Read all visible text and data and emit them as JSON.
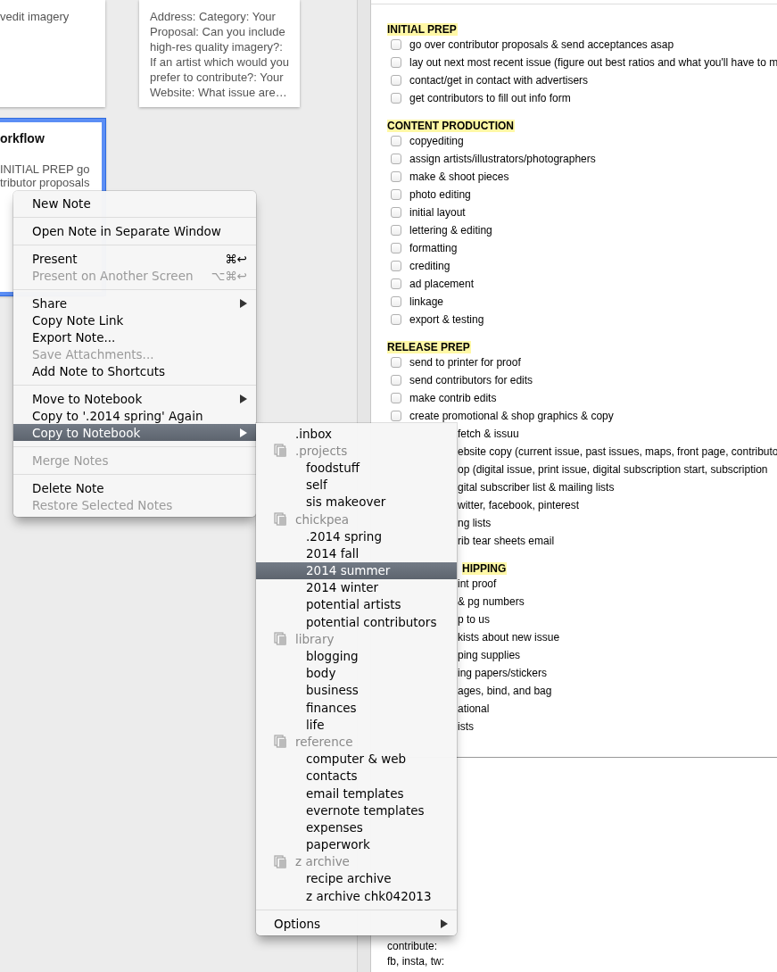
{
  "notes": [
    {
      "kind": "plain",
      "selected": false,
      "lines": [
        "vedit imagery"
      ]
    },
    {
      "kind": "plain",
      "selected": false,
      "lines": [
        "Address: Category: Your Proposal: Can you include high-res quality imagery?: If an artist which would you prefer to contribute?: Your Website: What issue are…"
      ]
    },
    {
      "kind": "titled",
      "selected": true,
      "title": "orkflow",
      "lines": [
        "INITIAL PREP go",
        "tributor proposals"
      ]
    }
  ],
  "context_menu": {
    "groups": [
      [
        {
          "label": "New Note",
          "disabled": false,
          "selected": false,
          "submenu": false
        }
      ],
      [
        {
          "label": "Open Note in Separate Window",
          "disabled": false,
          "selected": false,
          "submenu": false
        }
      ],
      [
        {
          "label": "Present",
          "disabled": false,
          "selected": false,
          "submenu": false,
          "shortcut": "⌘↩"
        },
        {
          "label": "Present on Another Screen",
          "disabled": true,
          "selected": false,
          "submenu": false,
          "shortcut": "⌥⌘↩"
        }
      ],
      [
        {
          "label": "Share",
          "disabled": false,
          "selected": false,
          "submenu": true
        },
        {
          "label": "Copy Note Link",
          "disabled": false,
          "selected": false,
          "submenu": false
        },
        {
          "label": "Export Note...",
          "disabled": false,
          "selected": false,
          "submenu": false
        },
        {
          "label": "Save Attachments...",
          "disabled": true,
          "selected": false,
          "submenu": false
        },
        {
          "label": "Add Note to Shortcuts",
          "disabled": false,
          "selected": false,
          "submenu": false
        }
      ],
      [
        {
          "label": "Move to Notebook",
          "disabled": false,
          "selected": false,
          "submenu": true
        },
        {
          "label": "Copy to '.2014 spring' Again",
          "disabled": false,
          "selected": false,
          "submenu": false
        },
        {
          "label": "Copy to Notebook",
          "disabled": false,
          "selected": true,
          "submenu": true
        }
      ],
      [
        {
          "label": "Merge Notes",
          "disabled": true,
          "selected": false,
          "submenu": false
        }
      ],
      [
        {
          "label": "Delete Note",
          "disabled": false,
          "selected": false,
          "submenu": false
        },
        {
          "label": "Restore Selected Notes",
          "disabled": true,
          "selected": false,
          "submenu": false
        }
      ]
    ]
  },
  "notebook_menu": {
    "items": [
      {
        "kind": "notebook",
        "label": ".inbox",
        "selected": false
      },
      {
        "kind": "stack",
        "label": ".projects",
        "children": [
          {
            "kind": "notebook",
            "label": "foodstuff",
            "selected": false
          },
          {
            "kind": "notebook",
            "label": "self",
            "selected": false
          },
          {
            "kind": "notebook",
            "label": "sis makeover",
            "selected": false
          }
        ]
      },
      {
        "kind": "stack",
        "label": "chickpea",
        "children": [
          {
            "kind": "notebook",
            "label": ".2014 spring",
            "selected": false
          },
          {
            "kind": "notebook",
            "label": "2014 fall",
            "selected": false
          },
          {
            "kind": "notebook",
            "label": "2014 summer",
            "selected": true
          },
          {
            "kind": "notebook",
            "label": "2014 winter",
            "selected": false
          },
          {
            "kind": "notebook",
            "label": "potential artists",
            "selected": false
          },
          {
            "kind": "notebook",
            "label": "potential contributors",
            "selected": false
          }
        ]
      },
      {
        "kind": "stack",
        "label": "library",
        "children": [
          {
            "kind": "notebook",
            "label": "blogging",
            "selected": false
          },
          {
            "kind": "notebook",
            "label": "body",
            "selected": false
          },
          {
            "kind": "notebook",
            "label": "business",
            "selected": false
          },
          {
            "kind": "notebook",
            "label": "finances",
            "selected": false
          },
          {
            "kind": "notebook",
            "label": "life",
            "selected": false
          }
        ]
      },
      {
        "kind": "stack",
        "label": "reference",
        "children": [
          {
            "kind": "notebook",
            "label": "computer & web",
            "selected": false
          },
          {
            "kind": "notebook",
            "label": "contacts",
            "selected": false
          },
          {
            "kind": "notebook",
            "label": "email templates",
            "selected": false
          },
          {
            "kind": "notebook",
            "label": "evernote templates",
            "selected": false
          },
          {
            "kind": "notebook",
            "label": "expenses",
            "selected": false
          },
          {
            "kind": "notebook",
            "label": "paperwork",
            "selected": false
          }
        ]
      },
      {
        "kind": "stack",
        "label": "z archive",
        "children": [
          {
            "kind": "notebook",
            "label": "recipe archive",
            "selected": false
          },
          {
            "kind": "notebook",
            "label": "z archive chk042013",
            "selected": false
          }
        ]
      }
    ],
    "options": {
      "label": "Options",
      "submenu": true
    }
  },
  "note": {
    "sections": [
      {
        "kind": "full",
        "heading": "INITIAL PREP",
        "items": [
          {
            "kind": "full",
            "text": "go over contributor proposals & send acceptances asap",
            "checked": false
          },
          {
            "kind": "full",
            "text": "lay out next most recent issue (figure out best ratios and what you'll have to m",
            "checked": false
          },
          {
            "kind": "full",
            "text": "contact/get in contact with advertisers",
            "checked": false
          },
          {
            "kind": "full",
            "text": "get contributors to fill out info form",
            "checked": false
          }
        ]
      },
      {
        "kind": "full",
        "heading": "CONTENT PRODUCTION",
        "items": [
          {
            "kind": "full",
            "text": "copyediting",
            "checked": false
          },
          {
            "kind": "full",
            "text": "assign artists/illustrators/photographers",
            "checked": false
          },
          {
            "kind": "full",
            "text": "make & shoot pieces",
            "checked": false
          },
          {
            "kind": "full",
            "text": "photo editing",
            "checked": false
          },
          {
            "kind": "full",
            "text": "initial layout",
            "checked": false
          },
          {
            "kind": "full",
            "text": "lettering & editing",
            "checked": false
          },
          {
            "kind": "full",
            "text": "formatting",
            "checked": false
          },
          {
            "kind": "full",
            "text": "crediting",
            "checked": false
          },
          {
            "kind": "full",
            "text": "ad placement",
            "checked": false
          },
          {
            "kind": "full",
            "text": "linkage",
            "checked": false
          },
          {
            "kind": "full",
            "text": "export & testing",
            "checked": false
          }
        ]
      },
      {
        "kind": "full",
        "heading": "RELEASE PREP",
        "items": [
          {
            "kind": "full",
            "text": "send to printer for proof",
            "checked": false
          },
          {
            "kind": "full",
            "text": "send contributors for edits",
            "checked": false
          },
          {
            "kind": "full",
            "text": "make contrib edits",
            "checked": false
          },
          {
            "kind": "full",
            "text": "create promotional & shop graphics & copy",
            "checked": false
          },
          {
            "kind": "partial",
            "text": "fetch & issuu"
          },
          {
            "kind": "partial",
            "text": "ebsite copy (current issue, past issues, maps, front page, contributo"
          },
          {
            "kind": "partial",
            "text": "op (digital issue, print issue, digital subscription start, subscription"
          },
          {
            "kind": "partial",
            "text": "gital subscriber list & mailing lists"
          },
          {
            "kind": "partial",
            "text": "witter, facebook, pinterest"
          },
          {
            "kind": "partial",
            "text": "ng lists"
          },
          {
            "kind": "partial",
            "text": "rib tear sheets email"
          }
        ]
      },
      {
        "kind": "partial",
        "heading": "HIPPING",
        "items": [
          {
            "kind": "partial",
            "text": "int proof"
          },
          {
            "kind": "partial",
            "text": "& pg numbers"
          },
          {
            "kind": "partial",
            "text": "p to us"
          },
          {
            "kind": "partial",
            "text": "kists about new issue"
          },
          {
            "kind": "partial",
            "text": "ping supplies"
          },
          {
            "kind": "partial",
            "text": "ing papers/stickers"
          },
          {
            "kind": "partial",
            "text": "ages, bind, and bag"
          },
          {
            "kind": "partial",
            "text": "ational"
          },
          {
            "kind": "partial",
            "text": "ists"
          }
        ]
      }
    ],
    "footer_lines": [
      "contribute:",
      "fb, insta, tw:"
    ]
  }
}
